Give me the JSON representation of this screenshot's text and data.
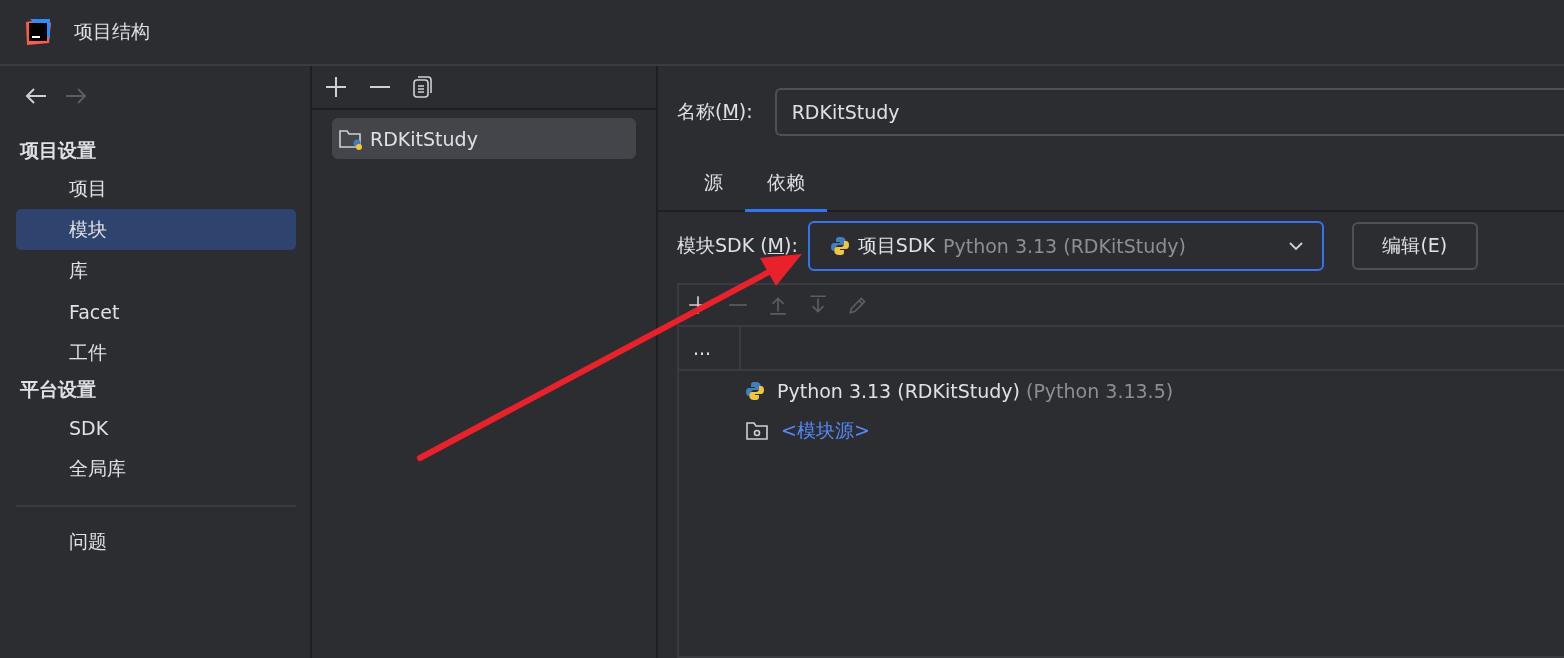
{
  "window": {
    "title": "项目结构"
  },
  "navigation": {
    "back_disabled": false,
    "forward_disabled": true
  },
  "sidebar": {
    "sections": [
      {
        "header": "项目设置",
        "items": [
          {
            "label": "项目",
            "selected": false
          },
          {
            "label": "模块",
            "selected": true
          },
          {
            "label": "库",
            "selected": false
          },
          {
            "label": "Facet",
            "selected": false
          },
          {
            "label": "工件",
            "selected": false
          }
        ]
      },
      {
        "header": "平台设置",
        "items": [
          {
            "label": "SDK",
            "selected": false
          },
          {
            "label": "全局库",
            "selected": false
          }
        ]
      }
    ],
    "footer_items": [
      {
        "label": "问题",
        "selected": false
      }
    ]
  },
  "modules": {
    "items": [
      {
        "label": "RDKitStudy",
        "selected": true
      }
    ]
  },
  "name_field": {
    "label_before": "名称(",
    "mnemonic": "M",
    "label_after": "):",
    "value": "RDKitStudy"
  },
  "tabs": [
    {
      "label": "源",
      "selected": false
    },
    {
      "label": "依赖",
      "selected": true
    }
  ],
  "sdk": {
    "label_before": "模块SDK (",
    "mnemonic": "M",
    "label_after": "):",
    "value": "项目SDK",
    "detail": "Python 3.13 (RDKitStudy)",
    "focused": true,
    "edit_button": "编辑(E)"
  },
  "dependencies": {
    "toolbar": [
      {
        "kind": "add",
        "disabled": false
      },
      {
        "kind": "remove",
        "disabled": true
      },
      {
        "kind": "up",
        "disabled": true
      },
      {
        "kind": "down",
        "disabled": true
      },
      {
        "kind": "edit",
        "disabled": true
      }
    ],
    "column_1": "...",
    "rows": [
      {
        "kind": "sdk",
        "label": "Python 3.13 (RDKitStudy)",
        "detail": "(Python 3.13.5)"
      },
      {
        "kind": "source",
        "label": "<模块源>"
      }
    ]
  },
  "annotation": {
    "kind": "arrow",
    "color": "#e8212b"
  }
}
